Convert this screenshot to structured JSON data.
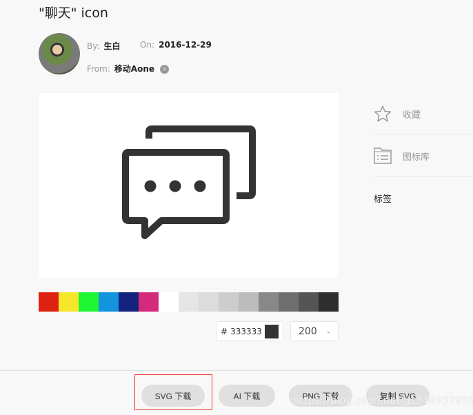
{
  "title": "\"聊天\" icon",
  "meta": {
    "by_label": "By:",
    "by": "生白",
    "on_label": "On:",
    "date": "2016-12-29",
    "from_label": "From:",
    "from": "移动Aone"
  },
  "icon": {
    "name": "chat-bubbles-icon",
    "color": "#333333"
  },
  "swatches": [
    "#dd2211",
    "#f5e62b",
    "#1ef533",
    "#1394dc",
    "#14237e",
    "#d42a7c",
    "#ffffff",
    "#e5e5e5",
    "#dcdcdc",
    "#cdcdcd",
    "#bcbcbc",
    "#888888",
    "#6f6f6f",
    "#555555",
    "#2e2e2e"
  ],
  "color_input": {
    "prefix": "#",
    "value": "333333"
  },
  "size_select": {
    "value": "200"
  },
  "sidebar": {
    "favorite": "收藏",
    "library": "图标库",
    "tags": "标签"
  },
  "buttons": {
    "svg": "SVG 下载",
    "ai": "AI 下载",
    "png": "PNG 下载",
    "copy": "复制 SVG"
  },
  "watermark": "https://blog.csdn.net/gs344937933"
}
